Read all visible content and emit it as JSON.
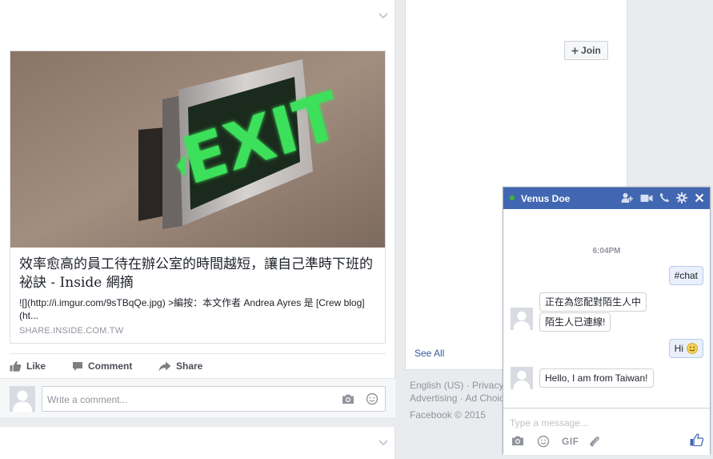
{
  "post": {
    "link_card": {
      "image_alt": "EXIT sign",
      "image_sign_text": "EXIT",
      "title": "效率愈高的員工待在辦公室的時間越短，讓自己準時下班的祕訣 - Inside 網摘",
      "description": "![](http://i.imgur.com/9sTBqQe.jpg) >編按：本文作者 Andrea Ayres 是 [Crew blog]\n(ht...",
      "domain": "SHARE.INSIDE.COM.TW"
    },
    "actions": {
      "like": "Like",
      "comment": "Comment",
      "share": "Share"
    },
    "comment_box": {
      "placeholder": "Write a comment..."
    }
  },
  "sidebar": {
    "join_label": "Join",
    "see_all": "See All"
  },
  "footer": {
    "line1": "English (US) · Privacy",
    "line2": "Advertising · Ad Choic",
    "copyright": "Facebook © 2015"
  },
  "chat": {
    "name": "Venus Doe",
    "status_color": "#42b72a",
    "header_color": "#4267b2",
    "timestamp": "6:04PM",
    "messages": [
      {
        "from": "me",
        "text": "#chat"
      },
      {
        "from": "them",
        "text": "正在為您配對陌生人中"
      },
      {
        "from": "them",
        "text": "陌生人已連線!"
      },
      {
        "from": "me",
        "text": "Hi"
      },
      {
        "from": "them",
        "text": "Hello, I am from Taiwan!"
      }
    ],
    "compose_placeholder": "Type a message...",
    "gif_label": "GIF"
  }
}
